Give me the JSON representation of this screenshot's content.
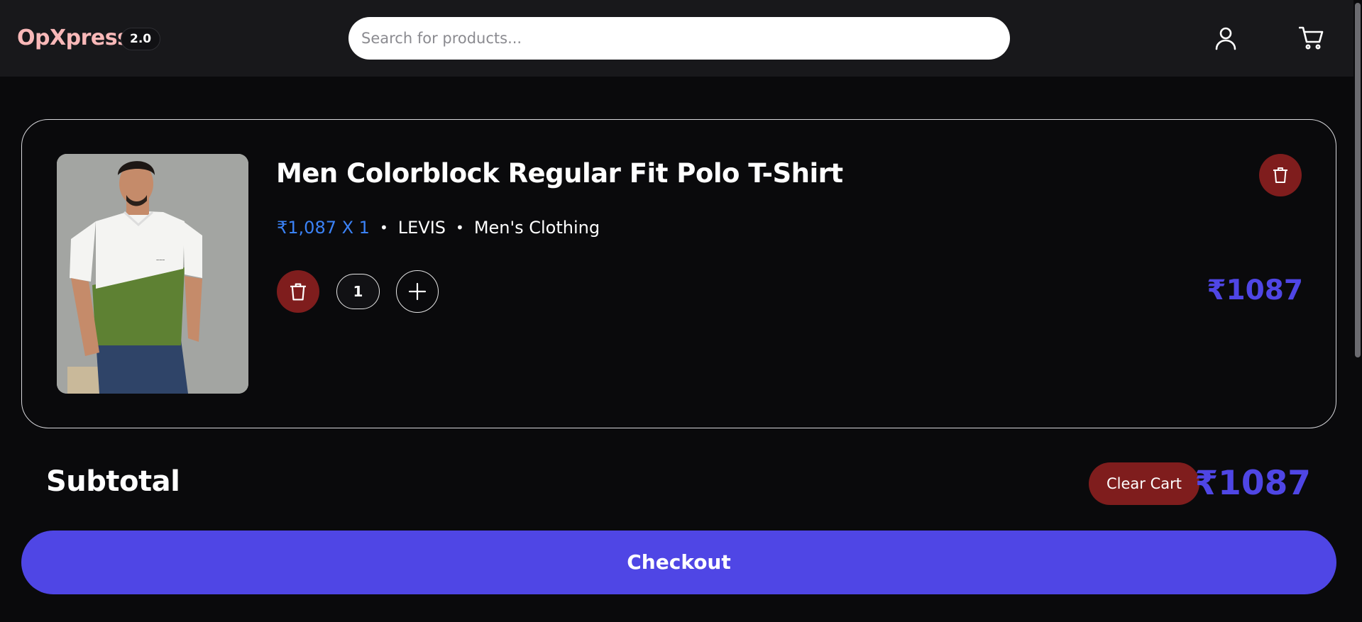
{
  "header": {
    "logo": "OpXpress",
    "version": "2.0",
    "search_placeholder": "Search for products...",
    "user_icon": "user-icon",
    "cart_icon": "cart-icon"
  },
  "cart_item": {
    "title": "Men Colorblock Regular Fit Polo T-Shirt",
    "price_qty": "₹1,087 X 1",
    "brand": "LEVIS",
    "category": "Men's Clothing",
    "quantity": "1",
    "line_total": "₹1087",
    "image_alt": "Men Colorblock Regular Fit Polo T-Shirt"
  },
  "summary": {
    "subtotal_label": "Subtotal",
    "clear_cart_label": "Clear Cart",
    "subtotal_value": "₹1087",
    "checkout_label": "Checkout"
  },
  "colors": {
    "accent": "#4f46e5",
    "price_blue": "#3b82f6",
    "danger": "#7f1d1d",
    "logo": "#f9b8b8",
    "background": "#0a0a0c"
  }
}
